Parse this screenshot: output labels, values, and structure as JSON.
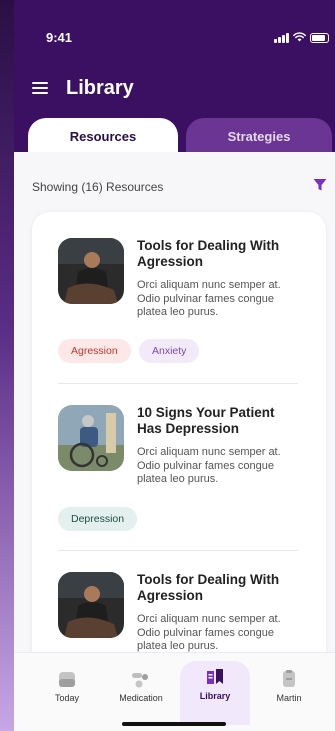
{
  "status": {
    "time": "9:41"
  },
  "header": {
    "title": "Library"
  },
  "tabs": [
    {
      "label": "Resources",
      "active": true
    },
    {
      "label": "Strategies",
      "active": false
    }
  ],
  "summary": {
    "showing": "Showing (16) Resources"
  },
  "cards": [
    {
      "title": "Tools for Dealing With Agression",
      "description": "Orci aliquam nunc semper at. Odio pulvinar fames congue platea leo purus.",
      "tags": [
        "Agression",
        "Anxiety"
      ]
    },
    {
      "title": "10 Signs Your Patient Has Depression",
      "description": "Orci aliquam nunc semper at. Odio pulvinar fames congue platea leo purus.",
      "tags": [
        "Depression"
      ]
    },
    {
      "title": "Tools for Dealing With Agression",
      "description": "Orci aliquam nunc semper at. Odio pulvinar fames congue platea leo purus.",
      "tags": []
    }
  ],
  "nav": [
    {
      "label": "Today",
      "icon": "today-icon"
    },
    {
      "label": "Medication",
      "icon": "pills-icon"
    },
    {
      "label": "Library",
      "icon": "library-icon",
      "active": true
    },
    {
      "label": "Martin",
      "icon": "profile-icon"
    }
  ],
  "colors": {
    "primary": "#3b1062",
    "tab_inactive": "#6a3593",
    "accent": "#7b2fbe"
  }
}
